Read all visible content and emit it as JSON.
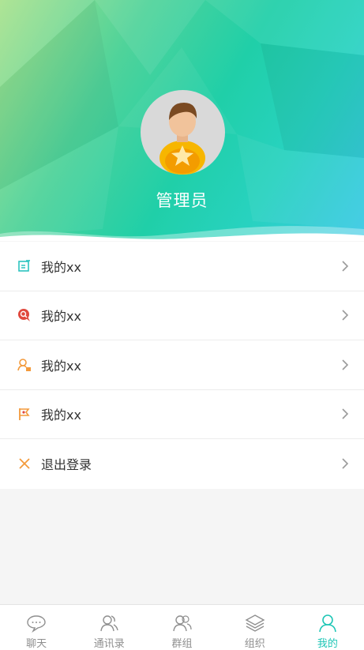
{
  "profile": {
    "username": "管理员"
  },
  "menu": {
    "items": [
      {
        "label": "我的xx",
        "icon": "edit-note-icon",
        "color": "#2cc3bf"
      },
      {
        "label": "我的xx",
        "icon": "search-badge-icon",
        "color": "#e0483d"
      },
      {
        "label": "我的xx",
        "icon": "user-lock-icon",
        "color": "#f39a3b"
      },
      {
        "label": "我的xx",
        "icon": "flag-icon",
        "color": "#f39a3b"
      },
      {
        "label": "退出登录",
        "icon": "close-icon",
        "color": "#f39a3b"
      }
    ]
  },
  "tabbar": {
    "tabs": [
      {
        "label": "聊天",
        "icon": "chat-bubble-icon",
        "active": false
      },
      {
        "label": "通讯录",
        "icon": "contacts-icon",
        "active": false
      },
      {
        "label": "群组",
        "icon": "group-icon",
        "active": false
      },
      {
        "label": "组织",
        "icon": "layers-icon",
        "active": false
      },
      {
        "label": "我的",
        "icon": "person-icon",
        "active": true
      }
    ]
  },
  "colors": {
    "accent": "#1fc6b6",
    "inactive": "#8f8f8f"
  }
}
